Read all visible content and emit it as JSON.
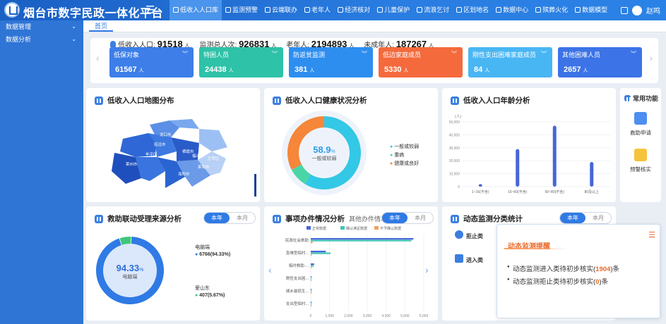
{
  "app": {
    "title": "烟台市数字民政一体化平台",
    "user": "赵鸣"
  },
  "nav": [
    {
      "label": "低收入人口库",
      "active": true
    },
    {
      "label": "监测预警"
    },
    {
      "label": "云端联办"
    },
    {
      "label": "老年人"
    },
    {
      "label": "经济核对"
    },
    {
      "label": "儿童保护"
    },
    {
      "label": "流浪乞讨"
    },
    {
      "label": "区划地名"
    },
    {
      "label": "数据中心"
    },
    {
      "label": "殡葬火化"
    },
    {
      "label": "数据模型"
    }
  ],
  "sidebar": [
    {
      "label": "数据管理"
    },
    {
      "label": "数据分析"
    }
  ],
  "tabs": [
    {
      "label": "首页"
    }
  ],
  "stats": {
    "low_income": {
      "label": "低收入人口:",
      "value": "91518",
      "unit": "人"
    },
    "monitor": {
      "label": "监测总人次:",
      "value": "926831",
      "unit": "人"
    },
    "elderly": {
      "label": "老年人:",
      "value": "2194893",
      "unit": "人"
    },
    "minor": {
      "label": "未成年人:",
      "value": "187267",
      "unit": "人"
    }
  },
  "cards": [
    {
      "title": "低保对象",
      "value": "61567",
      "unit": "人",
      "color": "#3d7ee8"
    },
    {
      "title": "特困人员",
      "value": "24438",
      "unit": "人",
      "color": "#2ec2a8"
    },
    {
      "title": "防返贫监测",
      "value": "381",
      "unit": "人",
      "color": "#2e8ef0"
    },
    {
      "title": "低边家庭成员",
      "value": "5330",
      "unit": "人",
      "color": "#f56a3c"
    },
    {
      "title": "刚性支出困难家庭成员",
      "value": "84",
      "unit": "人",
      "color": "#49b6f4"
    },
    {
      "title": "其他困难人员",
      "value": "2657",
      "unit": "人",
      "color": "#3c73e6"
    }
  ],
  "panels": {
    "map": {
      "title": "低收入人口地图分布",
      "regions": [
        "龙口市",
        "蓬莱区",
        "招远市",
        "栖霞市",
        "莱阳市",
        "莱州市",
        "海阳市",
        "福山区",
        "芝罘区",
        "牟平区"
      ]
    },
    "health": {
      "title": "低收入人口健康状况分析",
      "center_value": "58.9",
      "center_unit": "%",
      "center_label": "一般或较弱",
      "legend": [
        "一般或较弱",
        "重病",
        "健康或良好"
      ],
      "colors": [
        "#33c8e6",
        "#4ad5a6",
        "#f5863a"
      ]
    },
    "age": {
      "title": "低收入人口年龄分析"
    },
    "source": {
      "title": "救助联动受理来源分析",
      "toggle": [
        "本年",
        "本月"
      ],
      "center_value": "94.33",
      "center_unit": "%",
      "center_label": "电脑端",
      "items": [
        {
          "name": "电脑端",
          "value": "6766(94.33%)"
        },
        {
          "name": "爱山东",
          "value": "407(5.67%)"
        }
      ]
    },
    "matters": {
      "title": "事项办件情况分析",
      "subtitle": "其他办件情况分析",
      "toggle": [
        "本年",
        "本月"
      ],
      "legend": [
        "正常数据",
        "确认满足数据",
        "不予确认数据"
      ]
    },
    "dynamic": {
      "title": "动态监测分类统计",
      "toggle": [
        "本年",
        "本月"
      ],
      "items": [
        "拒止类",
        "进入类"
      ]
    }
  },
  "shortcuts": {
    "title": "常用功能",
    "items": [
      "救助申请",
      "预警核实"
    ]
  },
  "popup": {
    "title": "动态监测提醒",
    "rows": [
      {
        "prefix": "动态监测进入类待初步核实(",
        "value": "1904",
        "suffix": ")条"
      },
      {
        "prefix": "动态监测拒止类待初步核实(",
        "value": "0",
        "suffix": ")条"
      }
    ]
  },
  "chart_data": [
    {
      "type": "bar",
      "title": "低收入人口年龄分析",
      "ylabel": "(人)",
      "ylim": [
        0,
        50000
      ],
      "categories": [
        "1~16(不含)",
        "16~60(不含)",
        "60~80(不含)",
        "80及以上"
      ],
      "values": [
        2000,
        29000,
        47000,
        19000
      ]
    },
    {
      "type": "bar",
      "title": "事项办件情况分析",
      "orientation": "horizontal",
      "xlim": [
        0,
        6000
      ],
      "categories": [
        "民政社会救助",
        "急难型临时...",
        "临时救助-...",
        "刚性支出困...",
        "城乡最低生...",
        "支出型临时..."
      ],
      "series": [
        {
          "name": "正常数据",
          "values": [
            5450,
            800,
            180,
            40,
            20,
            20
          ]
        },
        {
          "name": "确认满足数据",
          "values": [
            5350,
            1050,
            150,
            30,
            15,
            15
          ]
        },
        {
          "name": "不予确认数据",
          "values": [
            100,
            50,
            30,
            10,
            5,
            5
          ]
        }
      ]
    },
    {
      "type": "pie",
      "title": "低收入人口健康状况分析",
      "categories": [
        "一般或较弱",
        "重病",
        "健康或良好"
      ],
      "values": [
        58.9,
        8.5,
        32.6
      ]
    },
    {
      "type": "pie",
      "title": "救助联动受理来源分析",
      "categories": [
        "电脑端",
        "爱山东"
      ],
      "values": [
        94.33,
        5.67
      ]
    }
  ]
}
